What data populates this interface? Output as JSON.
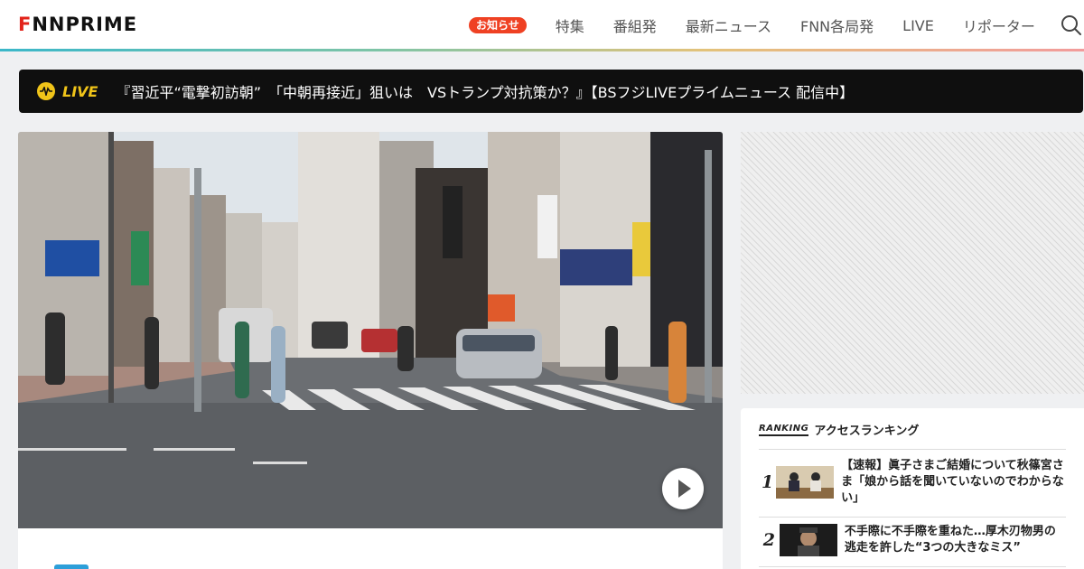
{
  "header": {
    "logo": {
      "part1": "F",
      "part2": "NN",
      "part3": " PRIME"
    },
    "badge": "お知らせ",
    "nav": [
      "特集",
      "番組発",
      "最新ニュース",
      "FNN各局発",
      "LIVE",
      "リポーター"
    ],
    "search_icon": "search-icon"
  },
  "live": {
    "label": "LIVE",
    "text": "『習近平“電撃初訪朝”　「中朝再接近」狙いは　VSトランプ対抗策か？』【BSフジLIVEプライムニュース 配信中】"
  },
  "video": {
    "play_icon": "play-icon"
  },
  "ranking": {
    "label_en": "RANKING",
    "label": "アクセスランキング",
    "items": [
      {
        "rank": "1",
        "title": "【速報】眞子さまご結婚について秋篠宮さま「娘から話を聞いていないのでわからない」"
      },
      {
        "rank": "2",
        "title": "不手際に不手際を重ねた…厚木刃物男の逃走を許した“3つの大きなミス”"
      }
    ]
  },
  "colors": {
    "accent": "#ef4123",
    "live": "#f0c419",
    "livebar": "#0f0f0f"
  }
}
